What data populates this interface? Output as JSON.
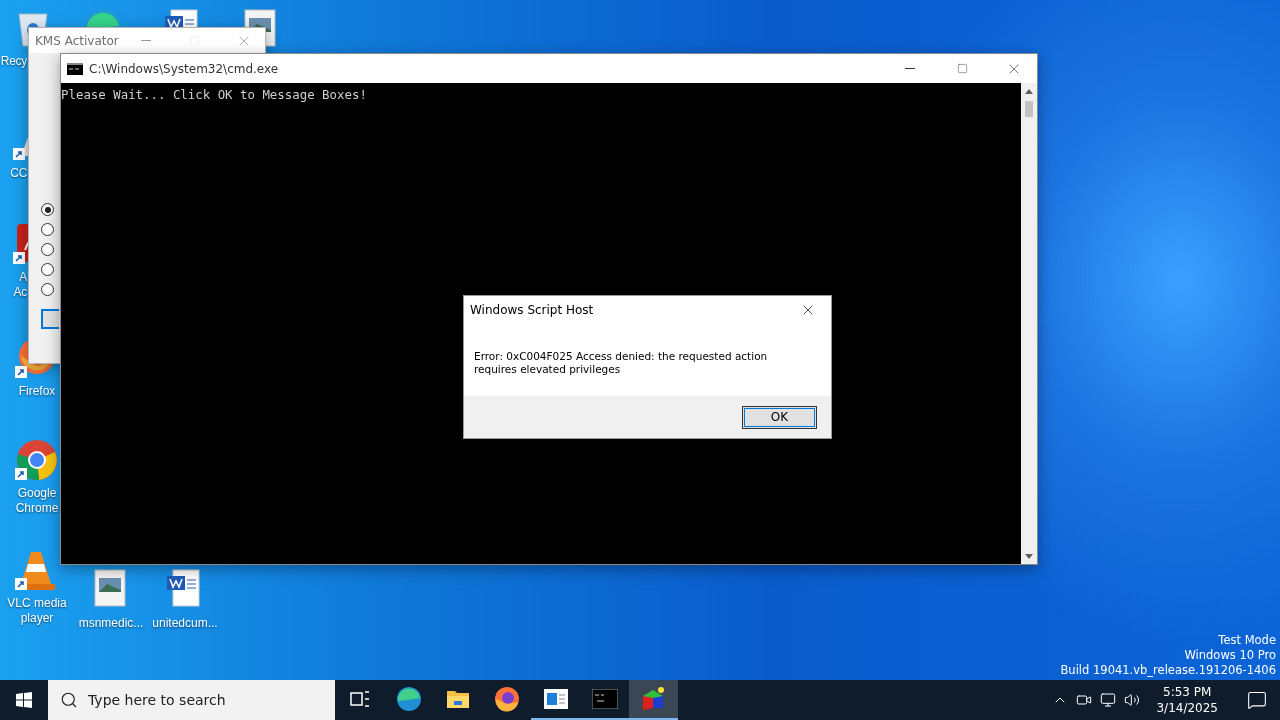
{
  "desktop_icons": [
    {
      "kind": "recycle",
      "label": "Recy",
      "shortcut": false
    },
    {
      "kind": "edge"
    },
    {
      "kind": "word"
    },
    {
      "kind": "image"
    },
    {
      "kind": "cc",
      "label": "CC",
      "shortcut": true
    },
    {
      "kind": "acrobat",
      "label": "A\nAc",
      "shortcut": true
    },
    {
      "kind": "firefox",
      "label": "Firefox",
      "shortcut": true
    },
    {
      "kind": "chrome",
      "label": "Google\nChrome",
      "shortcut": true
    },
    {
      "kind": "vlc",
      "label": "VLC media\nplayer",
      "shortcut": true
    },
    {
      "kind": "image",
      "label": "msnmedic...",
      "shortcut": false
    },
    {
      "kind": "word",
      "label": "unitedcum...",
      "shortcut": false
    }
  ],
  "kms_window": {
    "title": "KMS Activator",
    "options": [
      {
        "selected": true
      },
      {
        "selected": false
      },
      {
        "selected": false
      },
      {
        "selected": false
      },
      {
        "selected": false
      }
    ]
  },
  "cmd_window": {
    "title": "C:\\Windows\\System32\\cmd.exe",
    "output": "Please Wait... Click OK to Message Boxes!"
  },
  "dialog": {
    "title": "Windows Script Host",
    "message": "Error: 0xC004F025 Access denied: the requested action requires elevated privileges",
    "button": "OK"
  },
  "watermark": [
    "Test Mode",
    "Windows 10 Pro",
    "Build 19041.vb_release.191206-1406"
  ],
  "taskbar": {
    "search": {
      "placeholder": "Type here to search"
    },
    "apps": [
      {
        "kind": "taskview",
        "running": false,
        "active": false
      },
      {
        "kind": "edge",
        "running": false,
        "active": false
      },
      {
        "kind": "explorer",
        "running": false,
        "active": false
      },
      {
        "kind": "firefox",
        "running": false,
        "active": false
      },
      {
        "kind": "window",
        "running": true,
        "active": false
      },
      {
        "kind": "cmd",
        "running": true,
        "active": false
      },
      {
        "kind": "cube",
        "running": true,
        "active": true
      }
    ],
    "time": "5:53 PM",
    "date": "3/14/2025"
  }
}
